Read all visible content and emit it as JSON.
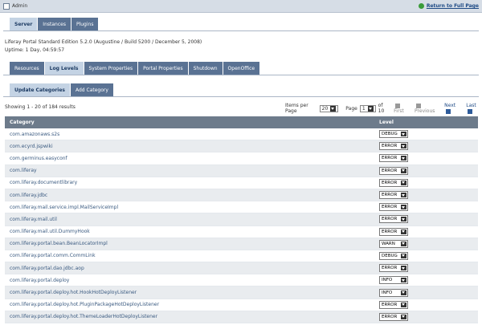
{
  "window": {
    "title": "Admin",
    "return_link": "Return to Full Page"
  },
  "top_tabs": [
    {
      "label": "Server",
      "active": true
    },
    {
      "label": "Instances",
      "active": false
    },
    {
      "label": "Plugins",
      "active": false
    }
  ],
  "info": {
    "version": "Liferay Portal Standard Edition 5.2.0 (Augustine / Build 5200 / December 5, 2008)",
    "uptime": "Uptime: 1 Day, 04:59:57"
  },
  "server_tabs": [
    {
      "label": "Resources",
      "active": false
    },
    {
      "label": "Log Levels",
      "active": true
    },
    {
      "label": "System Properties",
      "active": false
    },
    {
      "label": "Portal Properties",
      "active": false
    },
    {
      "label": "Shutdown",
      "active": false
    },
    {
      "label": "OpenOffice",
      "active": false
    }
  ],
  "category_tabs": [
    {
      "label": "Update Categories",
      "active": true
    },
    {
      "label": "Add Category",
      "active": false
    }
  ],
  "pagination": {
    "showing": "Showing 1 - 20 of 184 results",
    "items_per_page_label": "Items per Page",
    "items_per_page": "20",
    "page_label": "Page",
    "page": "1",
    "of_label": "of 10",
    "first": "First",
    "previous": "Previous",
    "next": "Next",
    "last": "Last"
  },
  "table": {
    "headers": {
      "category": "Category",
      "level": "Level"
    },
    "rows": [
      {
        "category": "com.amazonaws.s2s",
        "level": "DEBUG"
      },
      {
        "category": "com.ecyrd.jspwiki",
        "level": "ERROR"
      },
      {
        "category": "com.germinus.easyconf",
        "level": "ERROR"
      },
      {
        "category": "com.liferay",
        "level": "ERROR"
      },
      {
        "category": "com.liferay.documentlibrary",
        "level": "ERROR"
      },
      {
        "category": "com.liferay.jdbc",
        "level": "ERROR"
      },
      {
        "category": "com.liferay.mail.service.impl.MailServiceImpl",
        "level": "ERROR"
      },
      {
        "category": "com.liferay.mail.util",
        "level": "ERROR"
      },
      {
        "category": "com.liferay.mail.util.DummyHook",
        "level": "ERROR"
      },
      {
        "category": "com.liferay.portal.bean.BeanLocatorImpl",
        "level": "WARN"
      },
      {
        "category": "com.liferay.portal.comm.CommLink",
        "level": "DEBUG"
      },
      {
        "category": "com.liferay.portal.dao.jdbc.aop",
        "level": "ERROR"
      },
      {
        "category": "com.liferay.portal.deploy",
        "level": "INFO"
      },
      {
        "category": "com.liferay.portal.deploy.hot.HookHotDeployListener",
        "level": "INFO"
      },
      {
        "category": "com.liferay.portal.deploy.hot.PluginPackageHotDeployListener",
        "level": "ERROR"
      },
      {
        "category": "com.liferay.portal.deploy.hot.ThemeLoaderHotDeployListener",
        "level": "ERROR"
      }
    ]
  }
}
